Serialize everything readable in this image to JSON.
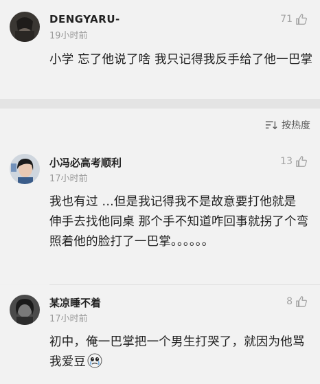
{
  "sort": {
    "label": "按热度",
    "icon": "sort-icon"
  },
  "comments": [
    {
      "username": "DENGYARU-",
      "time": "19小时前",
      "likes": "71",
      "text": "小学 忘了他说了啥 我只记得我反手给了他一巴掌",
      "avatar": "user-avatar"
    },
    {
      "username": "小冯必高考顺利",
      "time": "17小时前",
      "likes": "13",
      "text": "我也有过 ...但是我记得我不是故意要打他就是 伸手去找他同桌 那个手不知道咋回事就拐了个弯 照着他的脸打了一巴掌。。。。。。",
      "avatar": "user-avatar"
    },
    {
      "username": "某凉睡不着",
      "time": "17小时前",
      "likes": "8",
      "text": "初中，俺一巴掌把一个男生打哭了，就因为他骂我爱豆",
      "avatar": "user-avatar",
      "emoji": "crying-face-emoji"
    }
  ],
  "colors": {
    "background": "#f2f2f2",
    "divider": "#e4e4e4",
    "muted": "#9a9a9a"
  }
}
